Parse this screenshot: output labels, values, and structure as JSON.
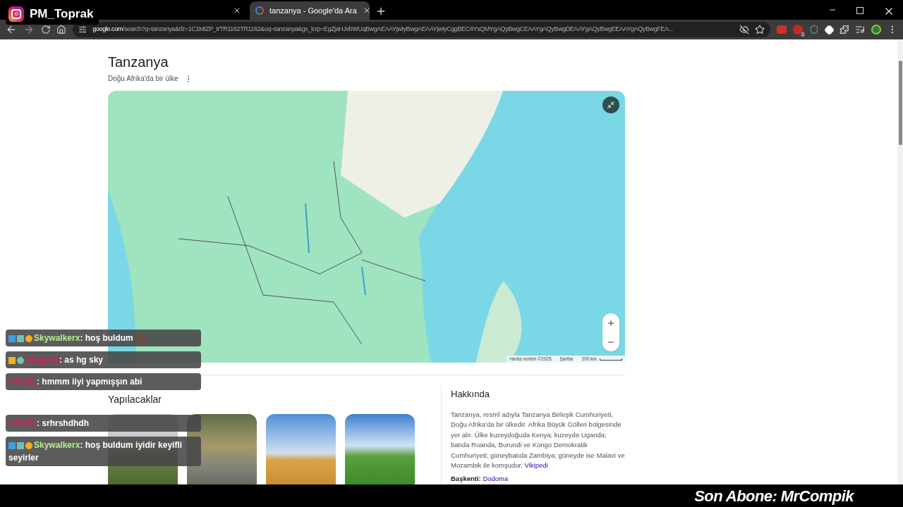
{
  "browser": {
    "tabs": [
      {
        "selected": false
      },
      {
        "title": "tanzanya - Google'da Ara",
        "selected": true
      }
    ],
    "url": {
      "host": "google.com",
      "path": "/search?q=tanzanya&rlz=1C1MIZP_trTR1162TR1162&oq=tanzanya&gs_lcrp=EgZjaHJvbWUqBwgAEAAYjwIyBwgAEAAYjwIyCggBEC4YsQMYgAQyBwgCEAAYgAQyBwgDEAAYgAQyBwgEEAAYgAQyBwgFEA..."
    },
    "extension_badge": "1"
  },
  "result": {
    "title": "Tanzanya",
    "subtitle": "Doğu Afrika'da bir ülke",
    "map": {
      "attribution": "Harita verileri ©2025",
      "terms": "Şartlar",
      "scale": "200 km"
    },
    "things_to_do": {
      "heading": "Yapılacaklar",
      "photos": [
        {
          "kind": "savanna"
        },
        {
          "kind": "elephants"
        },
        {
          "kind": "baobab"
        },
        {
          "kind": "plain"
        }
      ]
    },
    "about": {
      "heading": "Hakkında",
      "text": "Tanzanya, resmî adıyla Tanzanya Birleşik Cumhuriyeti, Doğu Afrika'da bir ülkedir. Afrika Büyük Gölleri bölgesinde yer alır. Ülke kuzeydoğuda Kenya; kuzeyde Uganda; batıda Ruanda, Burundi ve Kongo Demokratik Cumhuriyeti; güneybatıda Zambiya; güneyde ise Malavi ve Mozambik ile komşudur.",
      "source": "Vikipedi",
      "facts": [
        {
          "label": "Başkenti:",
          "value": "Dodoma"
        }
      ]
    }
  },
  "overlay": {
    "channel": "PM_Toprak",
    "last_subscriber": "Son Abone: MrCompik",
    "chat": [
      {
        "user": "Skywalkerx",
        "color": "#b4f08c",
        "kind": "subscriber",
        "message": ": hoş buldum",
        "avatar": true
      },
      {
        "user": "Alsgood",
        "color": "#d81b60",
        "kind": "gold",
        "message": ": as hg sky",
        "avatar": false
      },
      {
        "user": "HFbi22",
        "color": "#d81b60",
        "kind": "plain",
        "message": ": hmmm iiyi yapmışşın abi",
        "avatar": false
      },
      {
        "user": "HFbi22",
        "color": "#d81b60",
        "kind": "plain",
        "message": ": srhrshdhdh",
        "avatar": false
      },
      {
        "user": "Skywalkerx",
        "color": "#b4f08c",
        "kind": "subscriber",
        "message": ": hoş buldum iyidir keyifli seyirler",
        "avatar": false
      }
    ]
  }
}
